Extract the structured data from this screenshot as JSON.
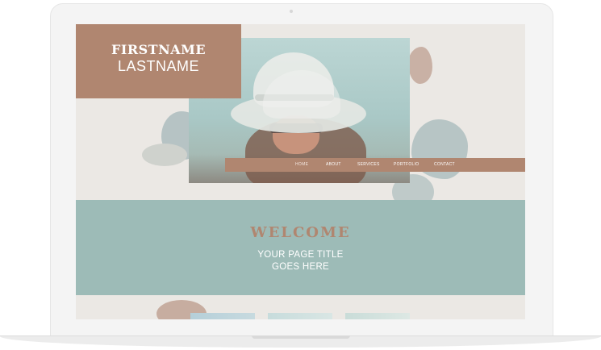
{
  "site": {
    "first_name": "FIRSTNAME",
    "last_name": "LASTNAME"
  },
  "nav": {
    "items": [
      {
        "label": "HOME"
      },
      {
        "label": "ABOUT"
      },
      {
        "label": "SERVICES"
      },
      {
        "label": "PORTFOLIO"
      },
      {
        "label": "CONTACT"
      }
    ]
  },
  "welcome": {
    "title": "WELCOME",
    "subtitle_line1": "YOUR PAGE TITLE",
    "subtitle_line2": "GOES HERE"
  },
  "colors": {
    "accent": "#b08670",
    "teal": "#9dbbb7",
    "background": "#ebe8e4"
  },
  "icons": {
    "camera": "laptop-camera-icon"
  }
}
